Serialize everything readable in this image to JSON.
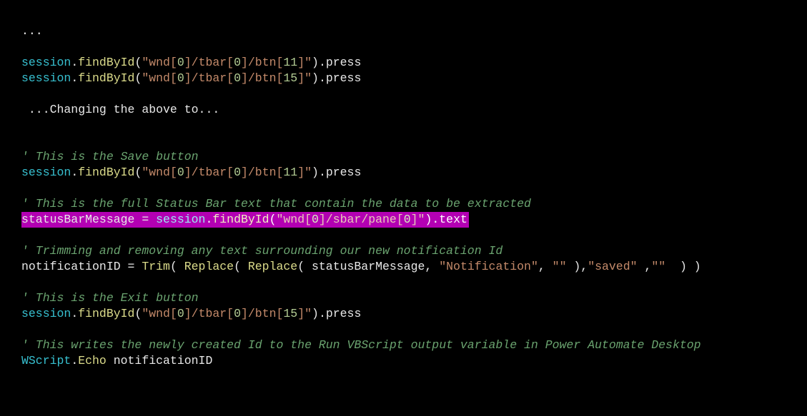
{
  "lines": {
    "l0": "...",
    "l1_obj": "session",
    "l1_dot": ".",
    "l1_fn": "findById",
    "l1_open": "(",
    "l1_s1": "\"wnd[",
    "l1_n1": "0",
    "l1_s2": "]/tbar[",
    "l1_n2": "0",
    "l1_s3": "]/btn[",
    "l1_n3": "11",
    "l1_s4": "]\"",
    "l1_close": ")",
    "l1_post": ".press",
    "l2_obj": "session",
    "l2_fn": "findById",
    "l2_s1": "\"wnd[",
    "l2_n1": "0",
    "l2_s2": "]/tbar[",
    "l2_n2": "0",
    "l2_s3": "]/btn[",
    "l2_n3": "15",
    "l2_s4": "]\"",
    "l2_post": ".press",
    "l3": " ...Changing the above to...",
    "c1": "' This is the Save button",
    "l4_obj": "session",
    "l4_fn": "findById",
    "l4_s1": "\"wnd[",
    "l4_n1": "0",
    "l4_s2": "]/tbar[",
    "l4_n2": "0",
    "l4_s3": "]/btn[",
    "l4_n3": "11",
    "l4_s4": "]\"",
    "l4_post": ".press",
    "c2": "' This is the full Status Bar text that contain the data to be extracted",
    "hl_pre": "statusBarMessage = ",
    "hl_obj": "session",
    "hl_fn": "findById",
    "hl_s1": "\"wnd[",
    "hl_n1": "0",
    "hl_s2": "]/sbar/pane[",
    "hl_n2": "0",
    "hl_s3": "]\"",
    "hl_post": ".text",
    "c3": "' Trimming and removing any text surrounding our new notification Id",
    "n_pre": "notificationID = ",
    "n_trim": "Trim",
    "n_op1": "( ",
    "n_rep1": "Replace",
    "n_op2": "( ",
    "n_rep2": "Replace",
    "n_op3": "( statusBarMessage, ",
    "n_str1": "\"Notification\"",
    "n_mid1": ", ",
    "n_str2": "\"\"",
    "n_mid2": " ),",
    "n_str3": "\"saved\"",
    "n_mid3": " ,",
    "n_str4": "\"\"",
    "n_end": "  ) )",
    "c4": "' This is the Exit button",
    "l5_obj": "session",
    "l5_fn": "findById",
    "l5_s1": "\"wnd[",
    "l5_n1": "0",
    "l5_s2": "]/tbar[",
    "l5_n2": "0",
    "l5_s3": "]/btn[",
    "l5_n3": "15",
    "l5_s4": "]\"",
    "l5_post": ".press",
    "c5": "' This writes the newly created Id to the Run VBScript output variable in Power Automate Desktop",
    "w_obj": "WScript",
    "w_dot": ".",
    "w_fn": "Echo",
    "w_arg": " notificationID"
  }
}
